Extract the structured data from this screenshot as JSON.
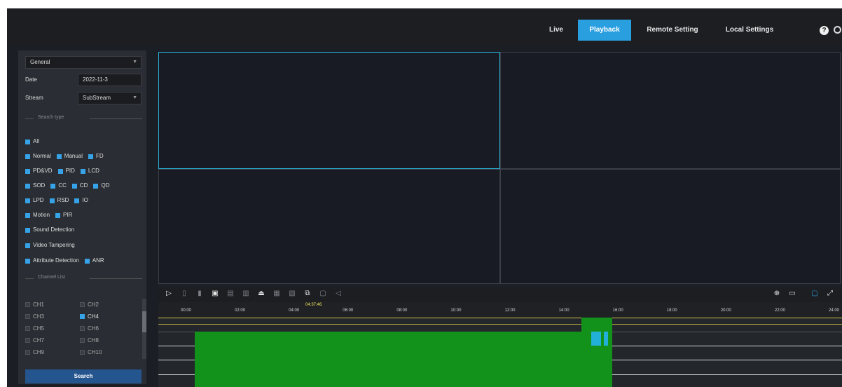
{
  "nav": {
    "items": [
      {
        "label": "Live",
        "active": false
      },
      {
        "label": "Playback",
        "active": true
      },
      {
        "label": "Remote Setting",
        "active": false
      },
      {
        "label": "Local Settings",
        "active": false
      }
    ],
    "help_glyph": "?"
  },
  "sidebar": {
    "mode_select": "General",
    "date_label": "Date",
    "date_value": "2022-11-3",
    "stream_label": "Stream",
    "stream_value": "SubStream",
    "search_type_title": "Search type",
    "search_types": [
      [
        "All"
      ],
      [
        "Normal",
        "Manual",
        "FD"
      ],
      [
        "PD&VD",
        "PID",
        "LCD"
      ],
      [
        "SOD",
        "CC",
        "CD",
        "QD"
      ],
      [
        "LPD",
        "RSD",
        "IO"
      ],
      [
        "Motion",
        "PIR"
      ],
      [
        "Sound Detection"
      ],
      [
        "Video Tampering"
      ],
      [
        "Attribute Detection",
        "ANR"
      ]
    ],
    "channel_list_title": "Channel List",
    "channels": [
      {
        "label": "CH1",
        "checked": false
      },
      {
        "label": "CH2",
        "checked": false
      },
      {
        "label": "CH3",
        "checked": false
      },
      {
        "label": "CH4",
        "checked": true
      },
      {
        "label": "CH5",
        "checked": false
      },
      {
        "label": "CH6",
        "checked": false
      },
      {
        "label": "CH7",
        "checked": false
      },
      {
        "label": "CH8",
        "checked": false
      },
      {
        "label": "CH9",
        "checked": false
      },
      {
        "label": "CH10",
        "checked": false
      }
    ],
    "search_button": "Search"
  },
  "timeline": {
    "cursor_time": "04:37:46",
    "tick_labels": [
      "00:00",
      "02:00",
      "04:00",
      "06:00",
      "08:00",
      "10:00",
      "12:00",
      "14:00",
      "16:00",
      "18:00",
      "20:00",
      "22:00",
      "24:00"
    ]
  },
  "colors": {
    "accent": "#2a9fe0",
    "record": "#13921b",
    "selected_window": "#2ab3d9",
    "cursor_label": "#f2e65b"
  }
}
